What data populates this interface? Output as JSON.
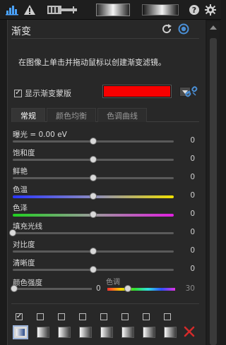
{
  "toolbar": {
    "icons": [
      "histogram-icon",
      "warning-icon",
      "filmstrip-icon",
      "gradient-preview",
      "gradient-preview-2",
      "help-icon",
      "gear-icon"
    ],
    "help_glyph": "?"
  },
  "panel": {
    "title": "渐变",
    "description": "在图像上单击并拖动鼠标以创建渐变滤镜。",
    "show_mask_label": "显示渐变蒙版",
    "show_mask_checked": true,
    "mask_color": "#f70000"
  },
  "tabs": [
    {
      "label": "常规",
      "active": true
    },
    {
      "label": "颜色均衡",
      "active": false
    },
    {
      "label": "色调曲线",
      "active": false
    }
  ],
  "sliders": [
    {
      "label": "曝光 = 0.00 eV",
      "value": "0",
      "pos": 0.5
    },
    {
      "label": "饱和度",
      "value": "0",
      "pos": 0.5
    },
    {
      "label": "鲜艳",
      "value": "0",
      "pos": 0.5
    },
    {
      "label": "色温",
      "value": "0",
      "pos": 0.5
    },
    {
      "label": "色泽",
      "value": "0",
      "pos": 0.5
    },
    {
      "label": "填充光线",
      "value": "0",
      "pos": 0.0
    },
    {
      "label": "对比度",
      "value": "0",
      "pos": 0.5
    },
    {
      "label": "清晰度",
      "value": "0",
      "pos": 0.5
    }
  ],
  "color_strength": {
    "label": "颜色强度",
    "value": "0",
    "hue_label": "色调",
    "hue_value": "30"
  },
  "colors": {
    "accent": "#4a8fd6",
    "mask_red": "#f70000",
    "delete_red": "#d42a2a"
  }
}
